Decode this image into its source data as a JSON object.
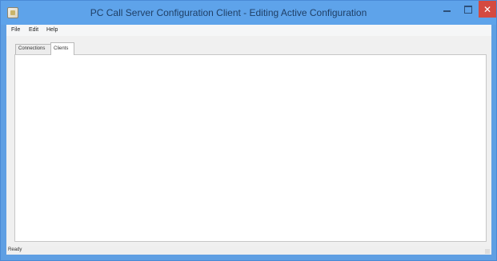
{
  "window": {
    "title": "PC Call Server Configuration Client - Editing Active Configuration",
    "icon": "app-icon",
    "controls": {
      "minimize_icon": "minimize-icon",
      "maximize_icon": "maximize-icon",
      "close_icon": "close-icon",
      "close_glyph": "✕"
    }
  },
  "menu": {
    "items": [
      {
        "label": "File"
      },
      {
        "label": "Edit"
      },
      {
        "label": "Help"
      }
    ]
  },
  "tabs": [
    {
      "label": "Connections",
      "active": false
    },
    {
      "label": "Clients",
      "active": true
    }
  ],
  "status": {
    "text": "Ready"
  },
  "colors": {
    "titlebar": "#5ea3ea",
    "close_button": "#d44a40",
    "client_background": "#f0f0f0",
    "panel_background": "#ffffff"
  }
}
